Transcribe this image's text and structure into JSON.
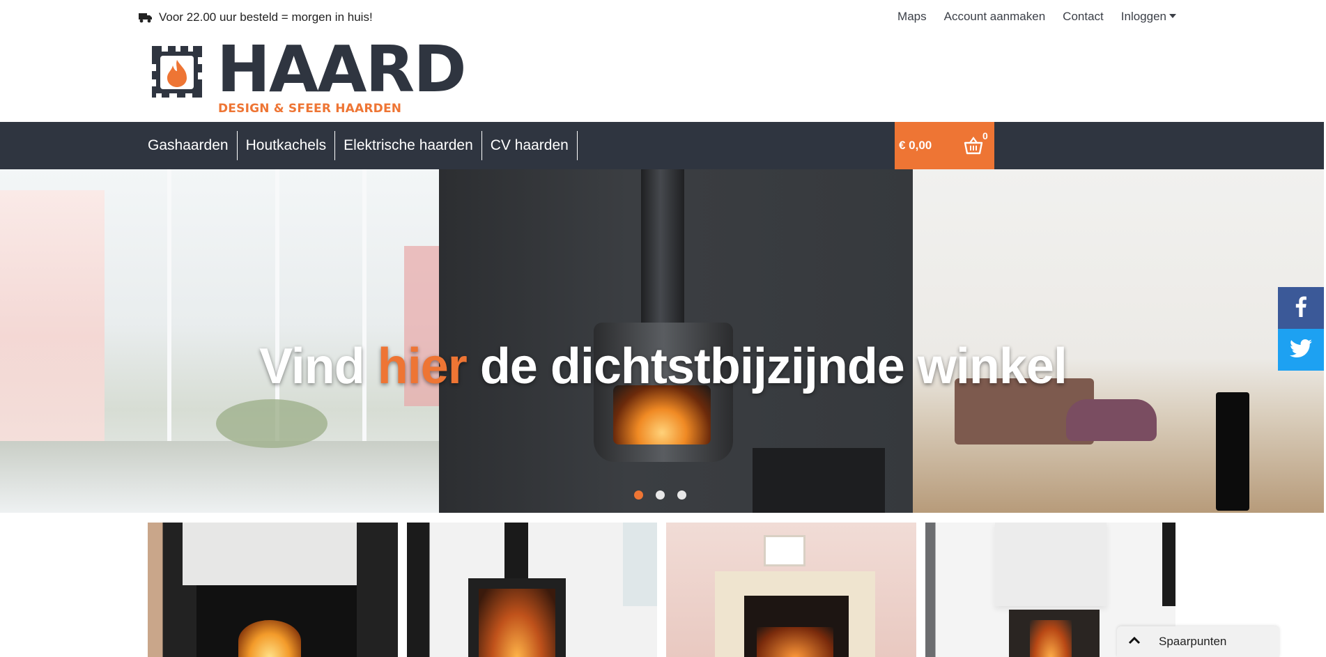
{
  "topbar": {
    "promo_text": "Voor 22.00 uur besteld = morgen in huis!",
    "links": [
      "Maps",
      "Account aanmaken",
      "Contact"
    ],
    "login_label": "Inloggen"
  },
  "logo": {
    "wordmark": "HAARD",
    "tagline": "DESIGN & SFEER HAARDEN",
    "colors": {
      "dark": "#2f3540",
      "accent": "#ee7534"
    }
  },
  "nav": {
    "items": [
      "Gashaarden",
      "Houtkachels",
      "Elektrische haarden",
      "CV haarden"
    ],
    "cart": {
      "price": "€ 0,00",
      "count": "0"
    }
  },
  "hero": {
    "title_before": "Vind ",
    "title_highlight": "hier",
    "title_after": " de dichtstbijzijnde winkel",
    "slides": 3,
    "active_slide": 1
  },
  "social": {
    "items": [
      "facebook",
      "twitter"
    ]
  },
  "products": {
    "tiles": 4
  },
  "savings_widget": {
    "label": "Spaarpunten"
  },
  "colors": {
    "accent": "#ee7534",
    "navbar": "#2f3540",
    "facebook": "#3b5998",
    "twitter": "#1da1f2"
  }
}
